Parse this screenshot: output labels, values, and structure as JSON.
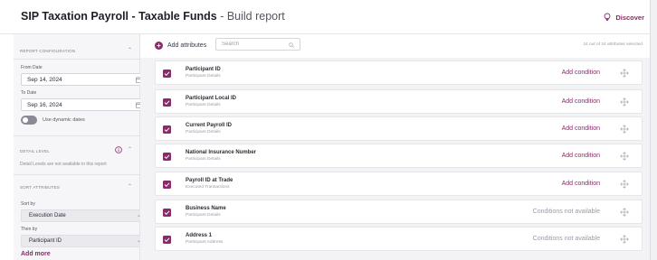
{
  "header": {
    "title_bold": "SIP Taxation Payroll - Taxable Funds",
    "title_suffix": " - Build report",
    "discover": "Discover"
  },
  "sidebar": {
    "report_config": {
      "heading": "REPORT CONFIGURATION",
      "from_label": "From Date",
      "from_value": "Sep 14, 2024",
      "to_label": "To Date",
      "to_value": "Sep 16, 2024",
      "dynamic_dates_label": "Use dynamic dates",
      "dynamic_dates_on": false
    },
    "detail_level": {
      "heading": "DETAIL LEVEL",
      "note": "Detail Levels are not available in this report"
    },
    "sort_attributes": {
      "heading": "SORT ATTRIBUTES",
      "sort_by_label": "Sort by",
      "sort_by_value": "Execution Date",
      "then_by_label": "Then by",
      "then_by_value": "Participant ID",
      "add_more": "Add more"
    }
  },
  "toolbar": {
    "add_attributes": "Add attributes",
    "search_placeholder": "Search",
    "selected_count": "24 out of 24 attributes selected"
  },
  "attributes": [
    {
      "title": "Participant ID",
      "subtitle": "Participant Details",
      "action": "Add condition",
      "available": true,
      "checked": true
    },
    {
      "title": "Participant Local ID",
      "subtitle": "Participant Details",
      "action": "Add condition",
      "available": true,
      "checked": true
    },
    {
      "title": "Current Payroll ID",
      "subtitle": "Participant Details",
      "action": "Add condition",
      "available": true,
      "checked": true
    },
    {
      "title": "National Insurance Number",
      "subtitle": "Participant Details",
      "action": "Add condition",
      "available": true,
      "checked": true
    },
    {
      "title": "Payroll ID at Trade",
      "subtitle": "Executed Transactions",
      "action": "Add condition",
      "available": true,
      "checked": true
    },
    {
      "title": "Business Name",
      "subtitle": "Participant Details",
      "action": "Conditions not available",
      "available": false,
      "checked": true
    },
    {
      "title": "Address 1",
      "subtitle": "Participant Address",
      "action": "Conditions not available",
      "available": false,
      "checked": true
    }
  ],
  "colors": {
    "accent": "#8a2a6a",
    "sidebar_bg": "#f6f6f8",
    "main_bg": "#f3f3f6",
    "muted_text": "#9a9aa6"
  },
  "icons": {
    "discover": "lightbulb-icon",
    "calendar": "calendar-icon",
    "info": "info-icon",
    "search": "search-icon",
    "drag": "drag-handle-icon",
    "checkbox": "checkmark-icon",
    "add": "plus-circle-icon"
  }
}
